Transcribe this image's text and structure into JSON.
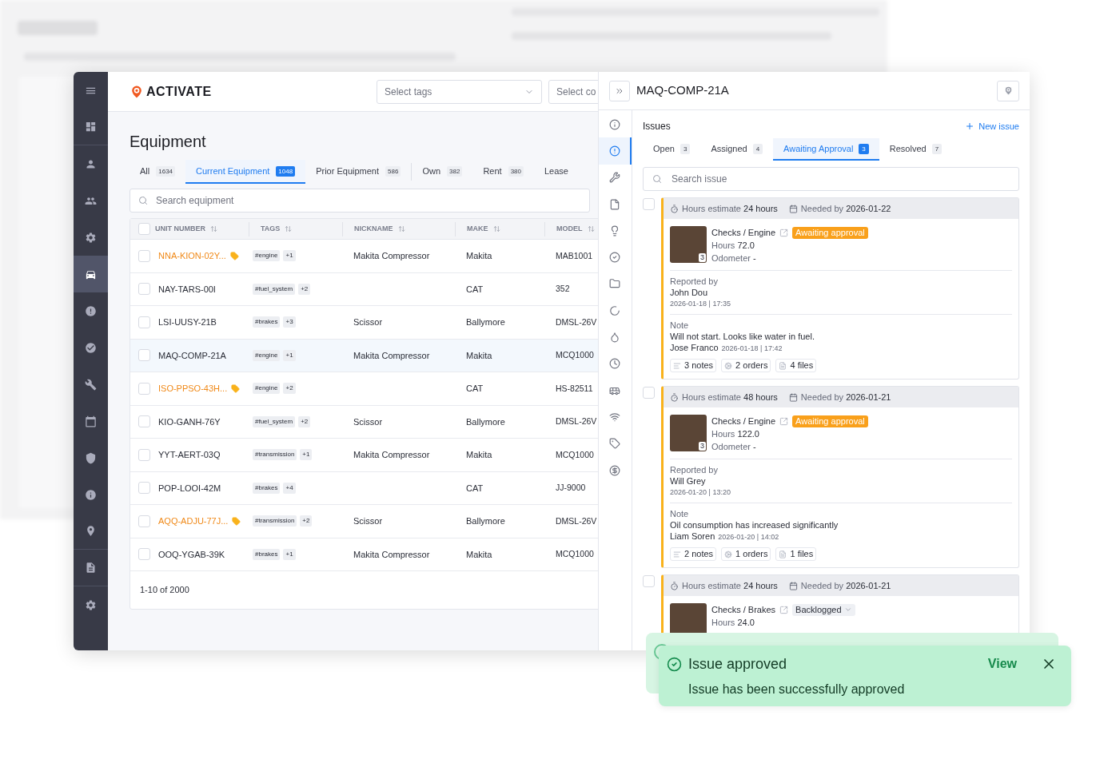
{
  "sidebar": {
    "items": [
      {
        "selected": false
      },
      {
        "selected": false
      },
      {
        "selected": false
      },
      {
        "selected": false
      },
      {
        "selected": false
      },
      {
        "selected": true
      },
      {
        "selected": false
      },
      {
        "selected": false
      },
      {
        "selected": false
      },
      {
        "selected": false
      },
      {
        "selected": false
      },
      {
        "selected": false
      },
      {
        "selected": false
      },
      {
        "selected": false
      },
      {
        "selected": false
      }
    ]
  },
  "header": {
    "logo": "ACTIVATE",
    "selects": [
      "Select tags",
      "Select co"
    ]
  },
  "equipment": {
    "title": "Equipment",
    "tabs": [
      {
        "label": "All",
        "count": "1634",
        "selected": false
      },
      {
        "label": "Current Equipment",
        "count": "1048",
        "selected": true
      },
      {
        "label": "Prior Equipment",
        "count": "586",
        "selected": false
      },
      {
        "label": "Own",
        "count": "382",
        "selected": false
      },
      {
        "label": "Rent",
        "count": "380",
        "selected": false
      },
      {
        "label": "Lease",
        "selected": false
      }
    ],
    "search": {
      "placeholder": "Search equipment"
    },
    "columns": [
      "UNIT NUMBER",
      "TAGS",
      "NICKNAME",
      "MAKE",
      "MODEL"
    ],
    "all_checked": false,
    "rows": [
      {
        "unit": "NNA-KION-02Y...",
        "flagged": true,
        "tag": "#engine",
        "more": "+1",
        "nickname": "Makita Compressor",
        "make": "Makita",
        "model": "MAB1001",
        "selected": false,
        "checked": false
      },
      {
        "unit": "NAY-TARS-00I",
        "flagged": false,
        "tag": "#fuel_system",
        "more": "+2",
        "make": "CAT",
        "model": "352",
        "selected": false,
        "checked": false
      },
      {
        "unit": "LSI-UUSY-21B",
        "flagged": false,
        "tag": "#brakes",
        "more": "+3",
        "nickname": "Scissor",
        "make": "Ballymore",
        "model": "DMSL-26V",
        "selected": false,
        "checked": false
      },
      {
        "unit": "MAQ-COMP-21A",
        "flagged": false,
        "tag": "#engine",
        "more": "+1",
        "nickname": "Makita Compressor",
        "make": "Makita",
        "model": "MCQ1000",
        "selected": true,
        "checked": false
      },
      {
        "unit": "ISO-PPSO-43H...",
        "flagged": true,
        "tag": "#engine",
        "more": "+2",
        "make": "CAT",
        "model": "HS-82511",
        "selected": false,
        "checked": false
      },
      {
        "unit": "KIO-GANH-76Y",
        "flagged": false,
        "tag": "#fuel_system",
        "more": "+2",
        "nickname": "Scissor",
        "make": "Ballymore",
        "model": "DMSL-26V",
        "selected": false,
        "checked": false
      },
      {
        "unit": "YYT-AERT-03Q",
        "flagged": false,
        "tag": "#transmission",
        "more": "+1",
        "nickname": "Makita Compressor",
        "make": "Makita",
        "model": "MCQ1000",
        "selected": false,
        "checked": false
      },
      {
        "unit": "POP-LOOI-42M",
        "flagged": false,
        "tag": "#brakes",
        "more": "+4",
        "make": "CAT",
        "model": "JJ-9000",
        "selected": false,
        "checked": false
      },
      {
        "unit": "AQQ-ADJU-77J...",
        "flagged": true,
        "tag": "#transmission",
        "more": "+2",
        "nickname": "Scissor",
        "make": "Ballymore",
        "model": "DMSL-26V",
        "selected": false,
        "checked": false
      },
      {
        "unit": "OOQ-YGAB-39K",
        "flagged": false,
        "tag": "#brakes",
        "more": "+1",
        "nickname": "Makita Compressor",
        "make": "Makita",
        "model": "MCQ1000",
        "selected": false,
        "checked": false
      }
    ],
    "footer": "1-10 of 2000"
  },
  "detail": {
    "title": "MAQ-COMP-21A",
    "rail": [
      {
        "selected": false
      },
      {
        "selected": true
      },
      {
        "selected": false
      },
      {
        "selected": false
      },
      {
        "selected": false
      },
      {
        "selected": false
      },
      {
        "selected": false
      },
      {
        "selected": false
      },
      {
        "selected": false
      },
      {
        "selected": false
      },
      {
        "selected": false
      },
      {
        "selected": false
      },
      {
        "selected": false
      },
      {
        "selected": false
      }
    ],
    "heading": "Issues",
    "new_issue": "New issue",
    "tabs": [
      {
        "label": "Open",
        "count": "3",
        "selected": false
      },
      {
        "label": "Assigned",
        "count": "4",
        "selected": false
      },
      {
        "label": "Awaiting Approval",
        "count": "3",
        "selected": true
      },
      {
        "label": "Resolved",
        "count": "7",
        "selected": false
      }
    ],
    "search": {
      "placeholder": "Search issue"
    },
    "issues": [
      {
        "checked": false,
        "hours_label": "Hours estimate",
        "hours": "24 hours",
        "needed_label": "Needed by",
        "needed": "2026-01-22",
        "category": "Checks / Engine",
        "status": {
          "label": "Awaiting approval",
          "kind": "approval"
        },
        "reading_label": "Hours",
        "reading": "72.0",
        "odometer_label": "Odometer",
        "odometer": "-",
        "photo_count": "3",
        "reported_label": "Reported by",
        "reporter": "John Dou",
        "reported_at": "2026-01-18 | 17:35",
        "note_label": "Note",
        "note": "Will not start. Looks like water in fuel.",
        "note_author": "Jose Franco",
        "note_at": "2026-01-18 | 17:42",
        "notes": "3 notes",
        "orders": "2 orders",
        "files": "4 files"
      },
      {
        "checked": false,
        "hours_label": "Hours estimate",
        "hours": "48 hours",
        "needed_label": "Needed by",
        "needed": "2026-01-21",
        "category": "Checks / Engine",
        "status": {
          "label": "Awaiting approval",
          "kind": "approval"
        },
        "reading_label": "Hours",
        "reading": "122.0",
        "odometer_label": "Odometer",
        "odometer": "-",
        "photo_count": "3",
        "reported_label": "Reported by",
        "reporter": "Will Grey",
        "reported_at": "2026-01-20 | 13:20",
        "note_label": "Note",
        "note": "Oil consumption has increased significantly",
        "note_author": "Liam Soren",
        "note_at": "2026-01-20 | 14:02",
        "notes": "2 notes",
        "orders": "1 orders",
        "files": "1 files"
      },
      {
        "checked": false,
        "hours_label": "Hours estimate",
        "hours": "24 hours",
        "needed_label": "Needed by",
        "needed": "2026-01-21",
        "category": "Checks / Brakes",
        "status": {
          "label": "Backlogged",
          "kind": "dropdown"
        },
        "reading_label": "Hours",
        "reading": "24.0"
      }
    ]
  },
  "toast": {
    "title": "Issue approved",
    "message": "Issue has been successfully approved",
    "action": "View"
  }
}
